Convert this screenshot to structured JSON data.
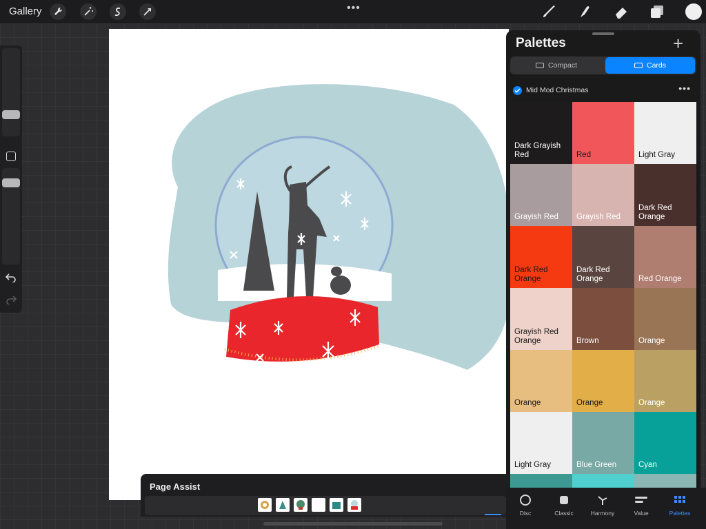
{
  "topbar": {
    "gallery_label": "Gallery",
    "tools_left": [
      "wrench-icon",
      "magic-wand-icon",
      "selection-icon",
      "transform-arrow-icon"
    ],
    "more_label": "•••",
    "tools_right": [
      "brush-icon",
      "smudge-icon",
      "eraser-icon",
      "layers-icon"
    ],
    "current_color": "#f0f0f0"
  },
  "palettes": {
    "title": "Palettes",
    "add_label": "+",
    "view_modes": [
      {
        "label": "Compact",
        "active": false
      },
      {
        "label": "Cards",
        "active": true
      }
    ],
    "palette_name": "Mid Mod Christmas",
    "palette_default": true,
    "cards": [
      {
        "label": "Dark Grayish Red",
        "color": "#1e1b1c",
        "text_color": "#ffffff"
      },
      {
        "label": "Red",
        "color": "#f0565a",
        "text_color": "#1a1a1a"
      },
      {
        "label": "Light Gray",
        "color": "#efefef",
        "text_color": "#1a1a1a"
      },
      {
        "label": "Grayish Red",
        "color": "#a89c9e",
        "text_color": "#ffffff"
      },
      {
        "label": "Grayish Red",
        "color": "#d8b4b1",
        "text_color": "#ffffff"
      },
      {
        "label": "Dark Red Orange",
        "color": "#4a302c",
        "text_color": "#ffffff"
      },
      {
        "label": "Dark Red Orange",
        "color": "#f53a12",
        "text_color": "#1a1a1a"
      },
      {
        "label": "Dark Red Orange",
        "color": "#5a443f",
        "text_color": "#ffffff"
      },
      {
        "label": "Red Orange",
        "color": "#b07e70",
        "text_color": "#ffffff"
      },
      {
        "label": "Grayish Red Orange",
        "color": "#efd2c9",
        "text_color": "#1a1a1a"
      },
      {
        "label": "Brown",
        "color": "#7b4e3e",
        "text_color": "#ffffff"
      },
      {
        "label": "Orange",
        "color": "#9a7555",
        "text_color": "#ffffff"
      },
      {
        "label": "Orange",
        "color": "#e8be80",
        "text_color": "#1a1a1a"
      },
      {
        "label": "Orange",
        "color": "#e2ae48",
        "text_color": "#1a1a1a"
      },
      {
        "label": "Orange",
        "color": "#bba063",
        "text_color": "#ffffff"
      },
      {
        "label": "Light Gray",
        "color": "#efefef",
        "text_color": "#1a1a1a"
      },
      {
        "label": "Blue Green",
        "color": "#79a9a4",
        "text_color": "#ffffff"
      },
      {
        "label": "Cyan",
        "color": "#07a199",
        "text_color": "#ffffff"
      },
      {
        "label": "",
        "color": "#3d9a92",
        "text_color": "#ffffff"
      },
      {
        "label": "",
        "color": "#4fd0cf",
        "text_color": "#ffffff"
      },
      {
        "label": "",
        "color": "#8ab7b4",
        "text_color": "#ffffff"
      }
    ]
  },
  "tabs": [
    {
      "label": "Disc",
      "icon": "disc-icon",
      "active": false
    },
    {
      "label": "Classic",
      "icon": "classic-icon",
      "active": false
    },
    {
      "label": "Harmony",
      "icon": "harmony-icon",
      "active": false
    },
    {
      "label": "Value",
      "icon": "value-icon",
      "active": false
    },
    {
      "label": "Palettes",
      "icon": "palettes-grid-icon",
      "active": true
    }
  ],
  "page_assist": {
    "title": "Page Assist",
    "selected_page": 6,
    "page_count": 6
  }
}
